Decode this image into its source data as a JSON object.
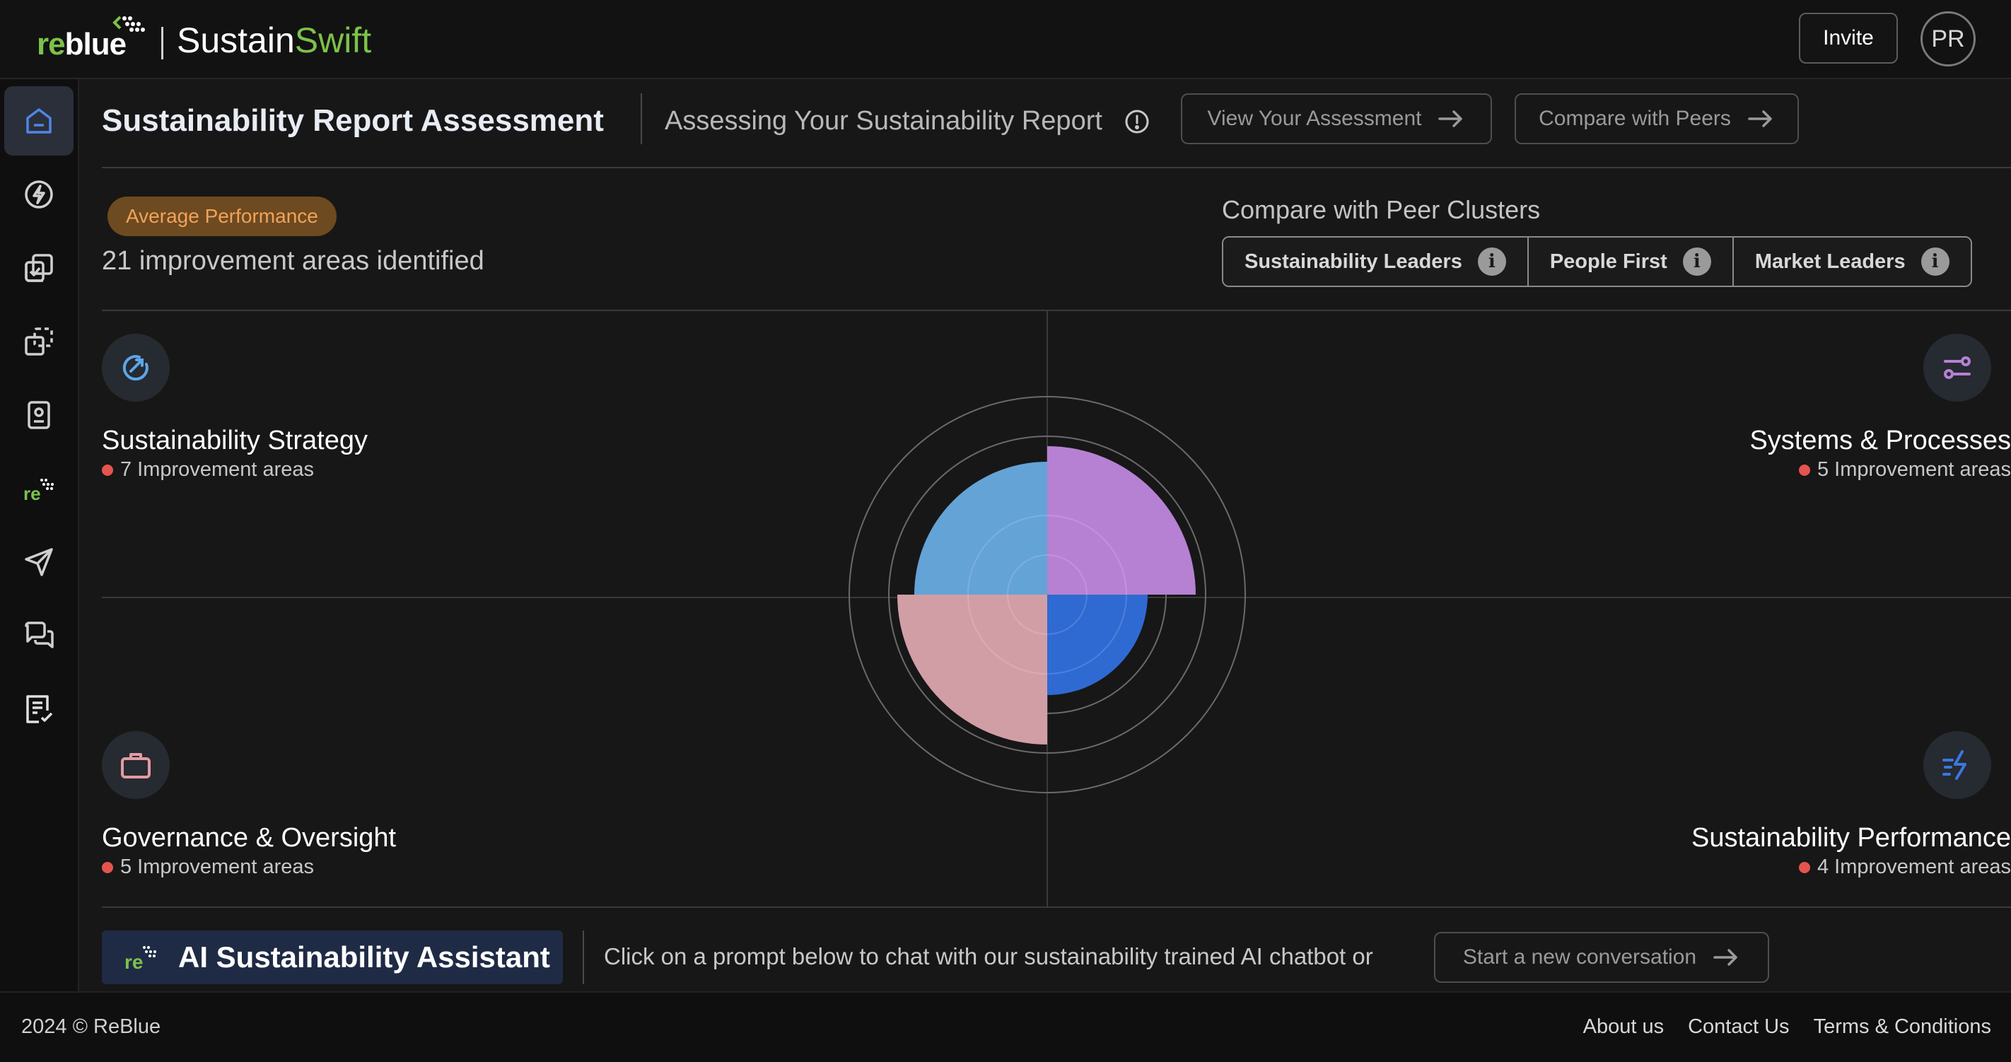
{
  "header": {
    "logo_re": "re",
    "logo_blue": "blue",
    "product_a": "Sustain",
    "product_b": "Swift",
    "invite_label": "Invite",
    "avatar_initials": "PR"
  },
  "sidebar": {
    "items": [
      {
        "icon": "home-icon",
        "active": true
      },
      {
        "icon": "lightning-icon"
      },
      {
        "icon": "checklist-cards-icon"
      },
      {
        "icon": "copy-dashed-icon"
      },
      {
        "icon": "id-badge-icon"
      },
      {
        "icon": "reblue-logo-icon"
      },
      {
        "icon": "send-icon"
      },
      {
        "icon": "chat-bubbles-icon"
      },
      {
        "icon": "report-check-icon"
      }
    ]
  },
  "page": {
    "title": "Sustainability Report Assessment",
    "subtitle": "Assessing Your Sustainability Report",
    "view_assessment_label": "View Your Assessment",
    "compare_peers_label": "Compare with Peers",
    "performance_badge": "Average Performance",
    "improvement_total": "21 improvement areas identified",
    "peer_title": "Compare with Peer Clusters",
    "peer_clusters": [
      "Sustainability Leaders",
      "People First",
      "Market Leaders"
    ]
  },
  "quadrants": {
    "strategy": {
      "title": "Sustainability Strategy",
      "sub": "7 Improvement areas",
      "color": "#64a3d6"
    },
    "systems": {
      "title": "Systems & Processes",
      "sub": "5 Improvement areas",
      "color": "#b681d3"
    },
    "governance": {
      "title": "Governance & Oversight",
      "sub": "5 Improvement areas",
      "color": "#d29ea6"
    },
    "performance": {
      "title": "Sustainability Performance",
      "sub": "4 Improvement areas",
      "color": "#2f6ad3"
    }
  },
  "assistant": {
    "label": "AI Sustainability Assistant",
    "prompt_text": "Click on a prompt below to chat with our sustainability trained AI chatbot or",
    "start_label": "Start a new conversation"
  },
  "footer": {
    "copyright": "2024 © ReBlue",
    "links": [
      "About us",
      "Contact Us",
      "Terms & Conditions"
    ]
  }
}
